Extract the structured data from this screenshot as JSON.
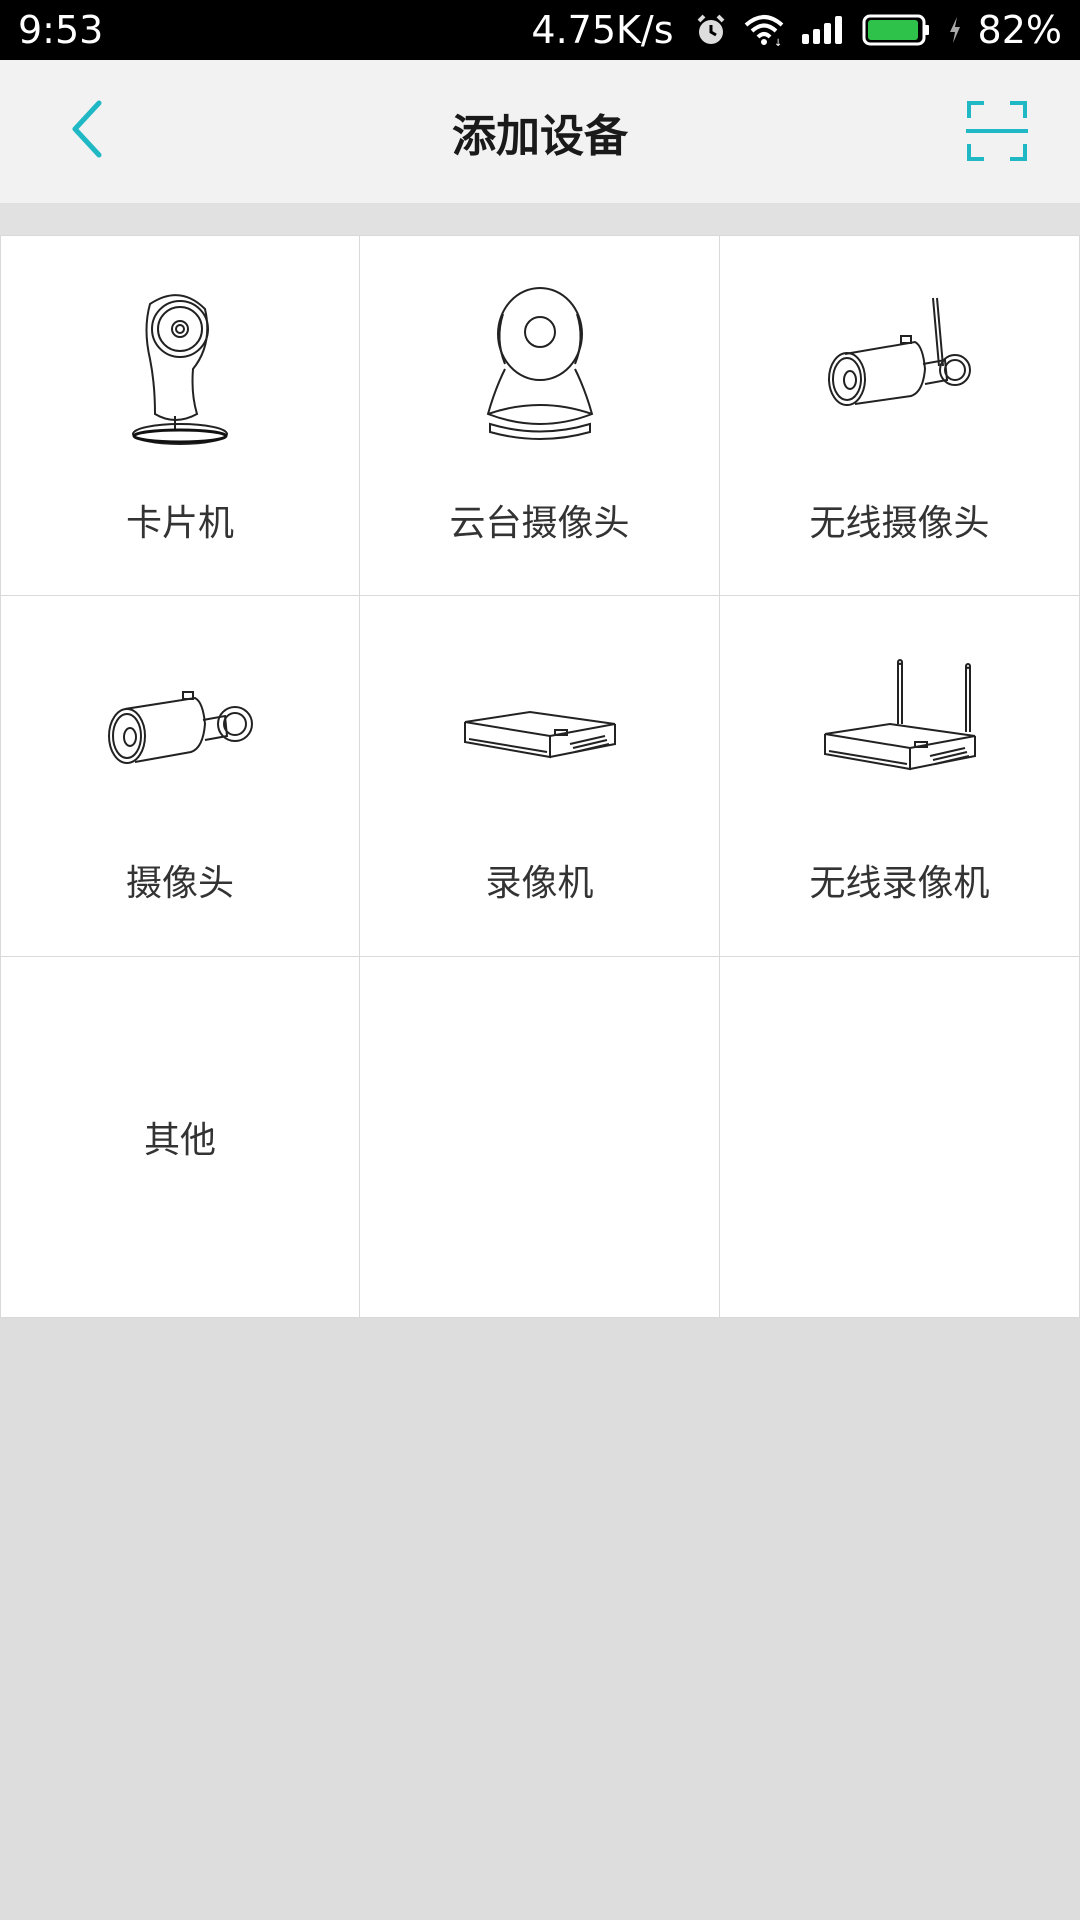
{
  "status_bar": {
    "time": "9:53",
    "net_speed": "4.75K/s",
    "battery_percent": "82%",
    "icons": [
      "alarm-icon",
      "wifi-icon",
      "signal-icon",
      "battery-icon",
      "charging-icon"
    ]
  },
  "header": {
    "title": "添加设备",
    "back_icon": "chevron-left-icon",
    "scan_icon": "scan-icon",
    "accent_color": "#1fb8c4"
  },
  "devices": [
    {
      "label": "卡片机",
      "icon": "card-camera-icon"
    },
    {
      "label": "云台摄像头",
      "icon": "pan-tilt-camera-icon"
    },
    {
      "label": "无线摄像头",
      "icon": "wireless-bullet-camera-icon"
    },
    {
      "label": "摄像头",
      "icon": "bullet-camera-icon"
    },
    {
      "label": "录像机",
      "icon": "nvr-icon"
    },
    {
      "label": "无线录像机",
      "icon": "wireless-nvr-icon"
    },
    {
      "label": "其他",
      "icon": ""
    }
  ]
}
